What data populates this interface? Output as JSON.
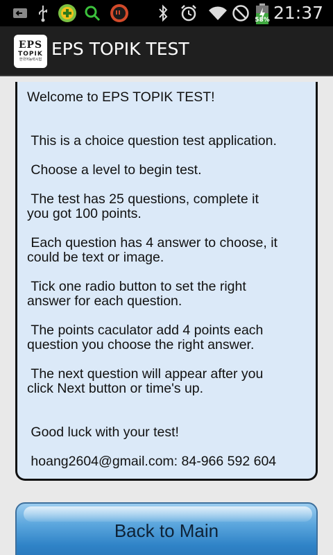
{
  "status_bar": {
    "time": "21:37",
    "battery_level": "58%",
    "icons": [
      "back-notification-icon",
      "usb-icon",
      "plus-app-icon",
      "search-notification-icon",
      "chat-notification-icon",
      "bluetooth-icon",
      "alarm-icon",
      "wifi-icon",
      "no-signal-icon",
      "battery-charging-icon"
    ]
  },
  "action_bar": {
    "app_icon": {
      "line1": "EPS",
      "line2": "TOPIK",
      "line3": "한국어능력시험"
    },
    "title": "EPS TOPIK TEST"
  },
  "content": {
    "paragraphs": [
      "Welcome to EPS TOPIK TEST!",
      " This is a choice question test application.",
      " Choose a level to begin test.",
      " The test has 25 questions, complete it\nyou got 100 points.",
      " Each question has 4 answer to choose, it\ncould be text or image.",
      " Tick one radio button to set the right\nanswer for each question.",
      " The points caculator add 4 points each\nquestion you choose the right answer.",
      " The next question will appear after you\nclick Next button or time's up.",
      " Good luck with your test!",
      " hoang2604@gmail.com: 84-966 592 604"
    ]
  },
  "back_button": {
    "label": "Back to Main"
  }
}
